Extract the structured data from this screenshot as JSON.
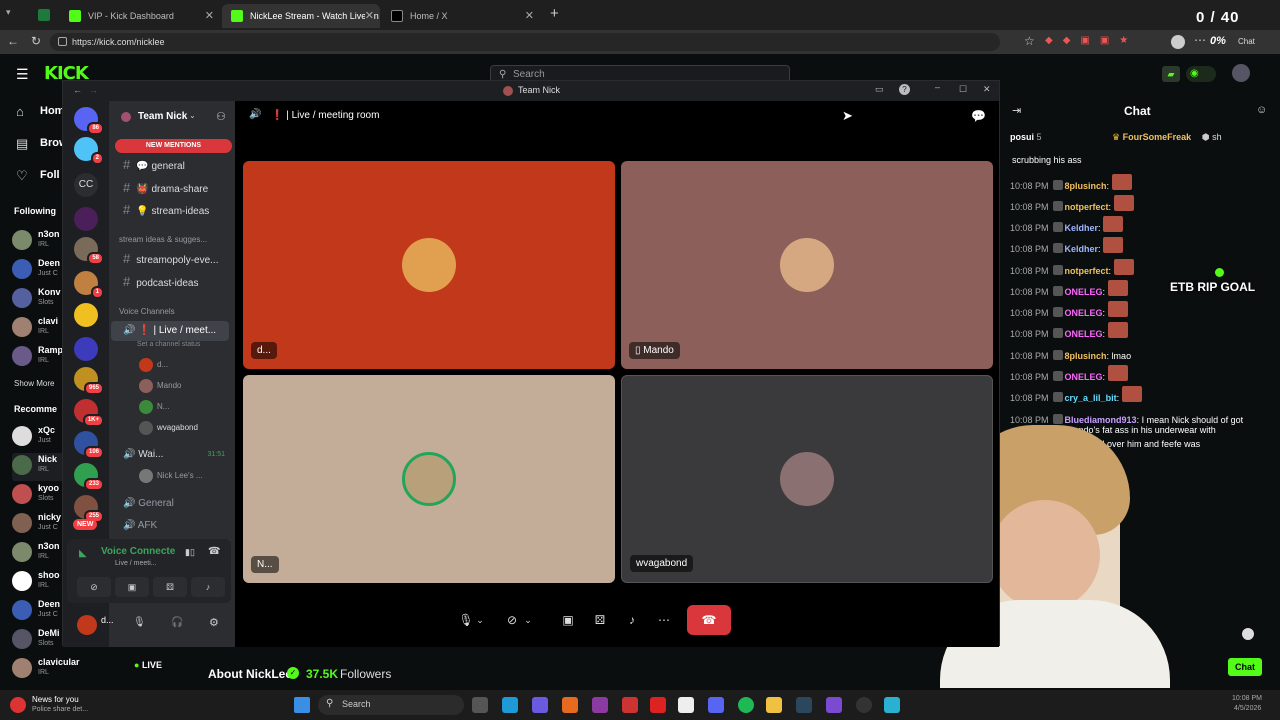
{
  "browser": {
    "tabs": [
      {
        "label": "VIP - Kick Dashboard"
      },
      {
        "label": "NickLee Stream - Watch Live on Ki"
      },
      {
        "label": "Home / X"
      }
    ],
    "url": "https://kick.com/nicklee",
    "score": "0 / 40",
    "ext_pct": "0%",
    "chat_btn": "Chat"
  },
  "kick": {
    "search_placeholder": "Search",
    "nav": [
      "Hom",
      "Brow",
      "Foll"
    ],
    "following_label": "Following",
    "show_more": "Show More",
    "recommended_label": "Recomme",
    "following": [
      {
        "name": "n3on",
        "sub": "IRL"
      },
      {
        "name": "Deen",
        "sub": "Just C"
      },
      {
        "name": "Konv",
        "sub": "Slots"
      },
      {
        "name": "clavi",
        "sub": "IRL"
      },
      {
        "name": "Ramp",
        "sub": "IRL"
      }
    ],
    "recommended": [
      {
        "name": "xQc",
        "sub": "Just"
      },
      {
        "name": "Nick",
        "sub": "IRL"
      },
      {
        "name": "kyoo",
        "sub": "Slots"
      },
      {
        "name": "nicky",
        "sub": "Just C"
      },
      {
        "name": "n3on",
        "sub": "IRL"
      },
      {
        "name": "shoo",
        "sub": "IRL"
      },
      {
        "name": "Deen",
        "sub": "Just C"
      },
      {
        "name": "DeMi",
        "sub": "Slots"
      }
    ],
    "bottom_channel": {
      "name": "clavicular",
      "sub": "IRL",
      "status": "LIVE"
    },
    "about": "About NickLee",
    "followers_count": "37.5K",
    "followers_label": "Followers"
  },
  "discord": {
    "window_title": "Team Nick",
    "server_name": "Team Nick",
    "new_mentions": "NEW MENTIONS",
    "channels": [
      {
        "name": "general",
        "emoji": "💬"
      },
      {
        "name": "drama-share",
        "emoji": "👹"
      },
      {
        "name": "stream-ideas",
        "emoji": "💡"
      }
    ],
    "category": "stream ideas & sugges...",
    "channels2": [
      "streamopoly-eve...",
      "podcast-ideas"
    ],
    "voice_category": "Voice Channels",
    "voice_active": "Live / meet...",
    "voice_status": "Set a channel status",
    "voice_users": [
      "d...",
      "Mando",
      "N...",
      "wvagabond"
    ],
    "waiting": {
      "name": "Wai...",
      "time": "31:51"
    },
    "waiting_user": "Nick Lee's ...",
    "general_voice": "General",
    "afk": "AFK",
    "voice_connected": "Voice Connecte",
    "voice_sub": "Live / meeti...",
    "self_name": "d...",
    "call_header": "Live / meeting room",
    "tiles": [
      {
        "label": "d...",
        "bg": "#c2381a"
      },
      {
        "label": "Mando",
        "bg": "#8c5f5a"
      },
      {
        "label": "N...",
        "bg": "#c4ad98"
      },
      {
        "label": "wvagabond",
        "bg": "#3a3a3c"
      }
    ],
    "server_badges": [
      "86",
      "2",
      "58",
      "1",
      "965",
      "1K+",
      "106",
      "233",
      "255"
    ],
    "new_badge": "NEW",
    "server_cc": "CC"
  },
  "chat": {
    "title": "Chat",
    "top_user1": "posui",
    "top_count": "5",
    "top_user2": "FourSomeFreak",
    "top_user3": "sh",
    "first_line": "scrubbing his ass",
    "messages": [
      {
        "time": "10:08 PM",
        "user": "8plusinch",
        "text": "",
        "color": "#f0c060"
      },
      {
        "time": "10:08 PM",
        "user": "notperfect",
        "text": "",
        "color": "#f0c060"
      },
      {
        "time": "10:08 PM",
        "user": "Keldher",
        "text": "",
        "color": "#9fb6ff"
      },
      {
        "time": "10:08 PM",
        "user": "Keldher",
        "text": "",
        "color": "#9fb6ff"
      },
      {
        "time": "10:08 PM",
        "user": "notperfect",
        "text": "",
        "color": "#f0c060"
      },
      {
        "time": "10:08 PM",
        "user": "ONELEG",
        "text": "",
        "color": "#ff66ff"
      },
      {
        "time": "10:08 PM",
        "user": "ONELEG",
        "text": "",
        "color": "#ff66ff"
      },
      {
        "time": "10:08 PM",
        "user": "ONELEG",
        "text": "",
        "color": "#ff66ff"
      },
      {
        "time": "10:08 PM",
        "user": "8plusinch",
        "text": "lmao",
        "color": "#f0c060"
      },
      {
        "time": "10:08 PM",
        "user": "ONELEG",
        "text": "",
        "color": "#ff66ff"
      },
      {
        "time": "10:08 PM",
        "user": "cry_a_lil_bit",
        "text": "",
        "color": "#66ddff"
      },
      {
        "time": "10:08 PM",
        "user": "Bluediamond913",
        "text": "I mean Nick should of got",
        "color": "#c7a0ff"
      }
    ],
    "cont1": "mando's fat ass in his underwear with",
    "cont2": "donuts all over him and feefe was",
    "goal": "ETB RIP GOAL",
    "chat_button": "Chat"
  },
  "taskbar": {
    "news_title": "News for you",
    "news_sub": "Police share det...",
    "search": "Search",
    "time": "10:08 PM",
    "date": "4/5/2026"
  }
}
